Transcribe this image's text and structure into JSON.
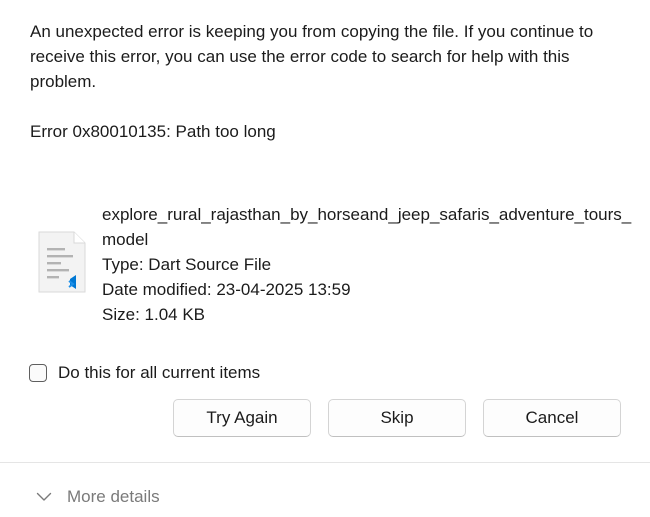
{
  "dialog": {
    "message": "An unexpected error is keeping you from copying the file. If you continue to receive this error, you can use the error code to search for help with this problem.",
    "error_code": "Error 0x80010135: Path too long"
  },
  "file": {
    "icon": "dart-file-icon",
    "name": "explore_rural_rajasthan_by_horseand_jeep_safaris_adventure_tours_model",
    "type": "Type: Dart Source File",
    "date_modified": "Date modified: 23-04-2025 13:59",
    "size": "Size: 1.04 KB"
  },
  "checkbox": {
    "label": "Do this for all current items",
    "checked": false
  },
  "buttons": {
    "try_again": "Try Again",
    "skip": "Skip",
    "cancel": "Cancel"
  },
  "footer": {
    "more_details": "More details",
    "icon": "chevron-down-icon"
  },
  "colors": {
    "text": "#1b1b1b",
    "muted": "#7a7a7a",
    "accent": "#0078d4",
    "divider": "#e5e5e5"
  }
}
